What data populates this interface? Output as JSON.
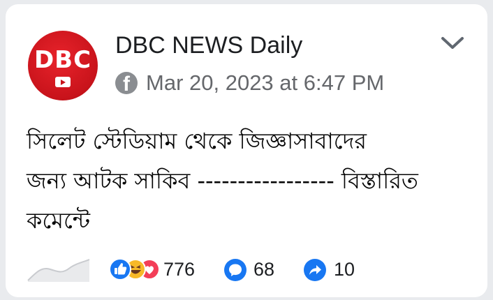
{
  "post": {
    "logo_text": "DBC",
    "page_name": "DBC NEWS Daily",
    "timestamp": "Mar 20, 2023 at 6:47 PM",
    "body_lines": [
      "সিলেট স্টেডিয়াম থেকে জিজ্ঞাসাবাদের",
      "জন্য আটক সাকিব ----------------- বিস্তারিত",
      "কমেন্টে"
    ]
  },
  "stats": {
    "reactions_count": "776",
    "comments_count": "68",
    "shares_count": "10"
  },
  "icons": {
    "platform": "facebook-icon",
    "menu": "chevron-down-icon",
    "reactions": [
      "like-icon",
      "haha-icon",
      "love-icon"
    ],
    "comments": "comment-icon",
    "shares": "share-icon",
    "insights": "sparkline-icon"
  },
  "colors": {
    "brand_red": "#c8131b",
    "like_blue": "#1877f2",
    "haha_yellow": "#f7b928",
    "love_pink": "#f33e58",
    "secondary_text": "#65676b"
  }
}
